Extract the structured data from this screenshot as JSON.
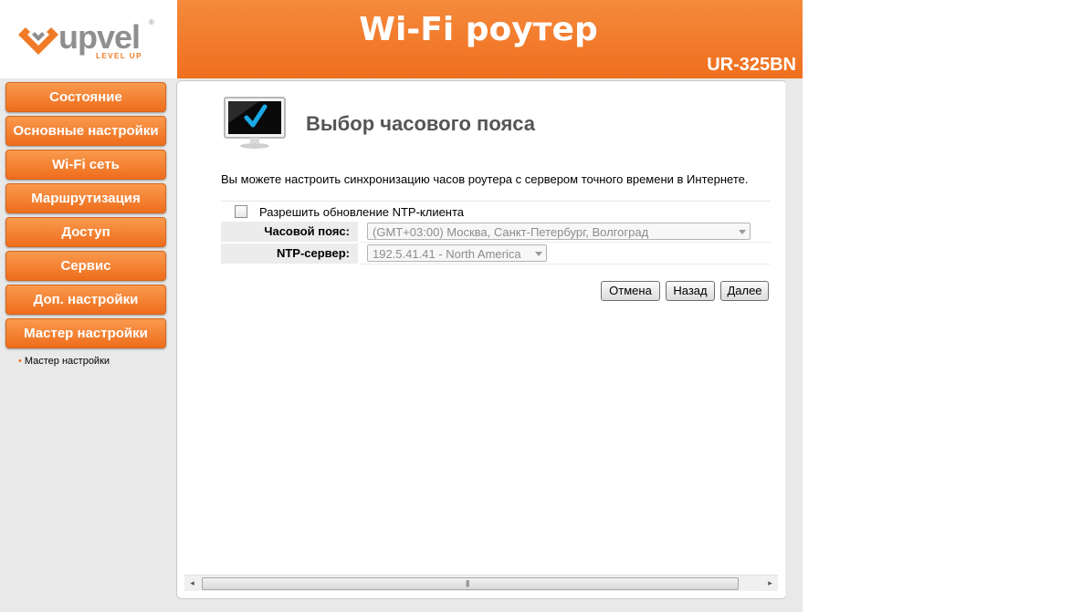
{
  "brand": {
    "logo_text": "upvel",
    "logo_tagline": "LEVEL UP",
    "logo_reg": "®",
    "accent_color": "#ef6f1e"
  },
  "header": {
    "title": "Wi-Fi роутер",
    "model": "UR-325BN"
  },
  "sidebar": {
    "items": [
      {
        "label": "Состояние"
      },
      {
        "label": "Основные настройки"
      },
      {
        "label": "Wi-Fi сеть"
      },
      {
        "label": "Маршрутизация"
      },
      {
        "label": "Доступ"
      },
      {
        "label": "Сервис"
      },
      {
        "label": "Доп. настройки"
      },
      {
        "label": "Мастер настройки"
      }
    ],
    "active_subitem": "Мастер настройки"
  },
  "main": {
    "icon": "monitor-check-icon",
    "title": "Выбор часового пояса",
    "description": "Вы можете настроить синхронизацию часов роутера с сервером точного времени в Интернете.",
    "ntp_checkbox": {
      "label": "Разрешить обновление NTP-клиента",
      "checked": false
    },
    "timezone": {
      "label": "Часовой пояс:",
      "value": "(GMT+03:00) Москва, Санкт-Петербург, Волгоград",
      "disabled": true
    },
    "ntp_server": {
      "label": "NTP-сервер:",
      "value": "192.5.41.41 - North America",
      "disabled": true
    },
    "buttons": {
      "cancel": "Отмена",
      "back": "Назад",
      "next": "Далее"
    }
  },
  "scrollbar": {
    "left_arrow": "◂",
    "right_arrow": "▸",
    "grip": "|||"
  }
}
